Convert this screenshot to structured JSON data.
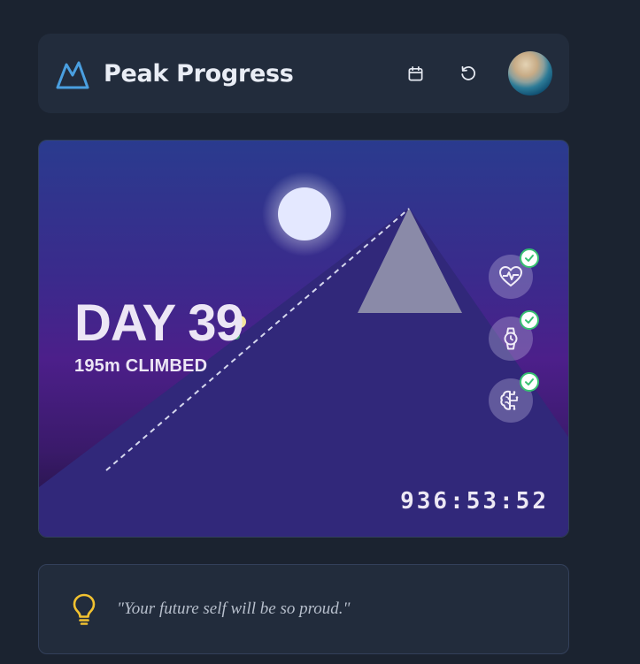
{
  "app": {
    "title": "Peak Progress",
    "brand_color": "#4a9fe0"
  },
  "header": {
    "actions": [
      {
        "icon": "calendar-icon"
      },
      {
        "icon": "refresh-icon"
      }
    ],
    "avatar": "user-avatar"
  },
  "progress": {
    "day_label": "DAY 39",
    "climbed_label": "195m CLIMBED",
    "timer": "936:53:52"
  },
  "habits": [
    {
      "icon": "heart-pulse-icon",
      "completed": true
    },
    {
      "icon": "watch-icon",
      "completed": true
    },
    {
      "icon": "brain-icon",
      "completed": true
    }
  ],
  "quote": {
    "text": "\"Your future self will be so proud.\"",
    "icon": "lightbulb-icon",
    "icon_color": "#f2c230"
  }
}
